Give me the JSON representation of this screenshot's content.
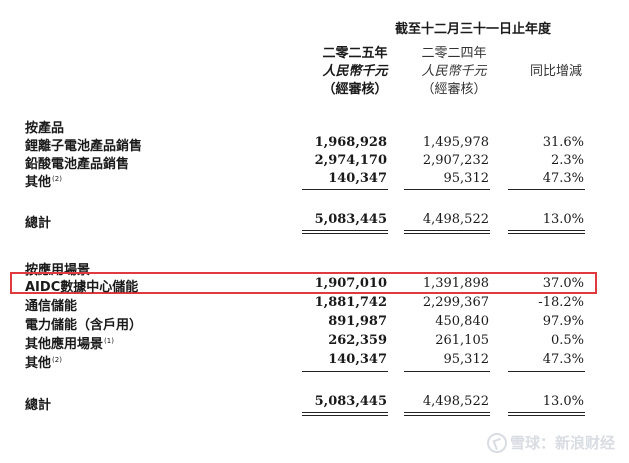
{
  "header": {
    "period": "截至十二月三十一日止年度",
    "col1": {
      "year": "二零二五年",
      "unit": "人民幣千元",
      "note": "（經審核）"
    },
    "col2": {
      "year": "二零二四年",
      "unit": "人民幣千元",
      "note": "（經審核）"
    },
    "col3": {
      "label": "同比增減"
    }
  },
  "by_product": {
    "title": "按產品",
    "rows": [
      {
        "label": "鋰離子電池產品銷售",
        "sup": "",
        "v2025": "1,968,928",
        "v2024": "1,495,978",
        "yoy": "31.6%"
      },
      {
        "label": "鉛酸電池產品銷售",
        "sup": "",
        "v2025": "2,974,170",
        "v2024": "2,907,232",
        "yoy": "2.3%"
      },
      {
        "label": "其他",
        "sup": "(2)",
        "v2025": "140,347",
        "v2024": "95,312",
        "yoy": "47.3%"
      }
    ],
    "total": {
      "label": "總計",
      "v2025": "5,083,445",
      "v2024": "4,498,522",
      "yoy": "13.0%"
    }
  },
  "by_scenario": {
    "title": "按應用場景",
    "rows": [
      {
        "label": "AIDC數據中心儲能",
        "sup": "",
        "v2025": "1,907,010",
        "v2024": "1,391,898",
        "yoy": "37.0%"
      },
      {
        "label": "通信儲能",
        "sup": "",
        "v2025": "1,881,742",
        "v2024": "2,299,367",
        "yoy": "-18.2%"
      },
      {
        "label": "電力儲能（含戶用）",
        "sup": "",
        "v2025": "891,987",
        "v2024": "450,840",
        "yoy": "97.9%"
      },
      {
        "label": "其他應用場景",
        "sup": "(1)",
        "v2025": "262,359",
        "v2024": "261,105",
        "yoy": "0.5%"
      },
      {
        "label": "其他",
        "sup": "(2)",
        "v2025": "140,347",
        "v2024": "95,312",
        "yoy": "47.3%"
      }
    ],
    "total": {
      "label": "總計",
      "v2025": "5,083,445",
      "v2024": "4,498,522",
      "yoy": "13.0%"
    }
  },
  "watermark": {
    "text": "雪球：新浪财经"
  },
  "colors": {
    "highlight": "#e0393e",
    "text": "#1a1a1a"
  }
}
